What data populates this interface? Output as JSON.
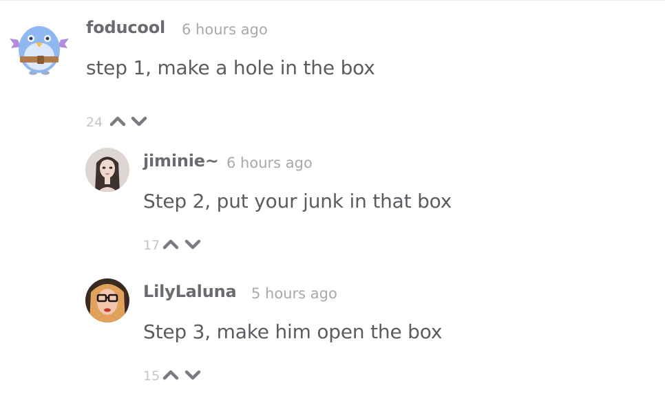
{
  "comments": [
    {
      "username": "foducool",
      "time": "6 hours ago",
      "text": "step 1, make a hole in the box",
      "votes": "24",
      "avatar": "penguin-bat-avatar"
    },
    {
      "username": "jiminie~",
      "time": "6 hours ago",
      "text": "Step 2, put your junk in that box",
      "votes": "17",
      "avatar": "girl-portrait-avatar"
    },
    {
      "username": "LilyLaluna",
      "time": "5 hours ago",
      "text": "Step 3, make him open the box",
      "votes": "15",
      "avatar": "woman-glasses-avatar"
    }
  ],
  "colors": {
    "username": "#6a6a70",
    "timestamp": "#a8a8ae",
    "text": "#5b5b62",
    "votes": "#c4c4c8",
    "arrows": "#7a7a80"
  },
  "icons": {
    "upvote": "chevron-up-icon",
    "downvote": "chevron-down-icon"
  }
}
